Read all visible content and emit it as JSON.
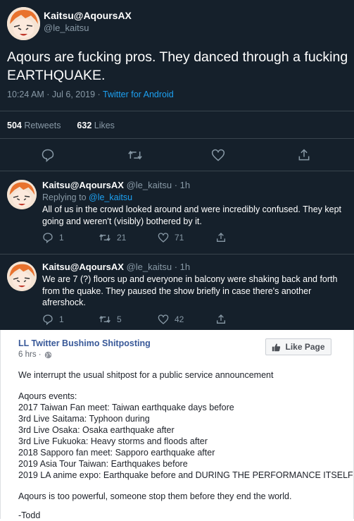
{
  "main_tweet": {
    "display_name": "Kaitsu@AqoursAX",
    "handle": "@le_kaitsu",
    "text": "Aqours are fucking pros. They danced through a fucking EARTHQUAKE.",
    "time": "10:24 AM · Jul 6, 2019 · ",
    "source": "Twitter for Android",
    "retweets_count": "504",
    "retweets_label": " Retweets",
    "likes_count": "632",
    "likes_label": " Likes"
  },
  "replies": [
    {
      "display_name": "Kaitsu@AqoursAX",
      "handle_time": "@le_kaitsu · 1h",
      "replying_prefix": "Replying to ",
      "replying_handle": "@le_kaitsu",
      "text": "All of us in the crowd looked around and were incredibly confused. They kept going and weren't (visibly) bothered by it.",
      "reply_count": "1",
      "retweet_count": "21",
      "like_count": "71"
    },
    {
      "display_name": "Kaitsu@AqoursAX",
      "handle_time": "@le_kaitsu · 1h",
      "text": "We are 7 (?) floors up and everyone in balcony were shaking back and forth from the quake. They paused the show briefly in case there's another afrershock.",
      "reply_count": "1",
      "retweet_count": "5",
      "like_count": "42"
    }
  ],
  "facebook_post": {
    "page_name": "LL Twitter Bushimo Shitposting",
    "time": "6 hrs · ",
    "like_page_label": "Like Page",
    "intro": "We interrupt the usual shitpost for a public service announcement",
    "events_heading": "Aqours events:",
    "events": [
      "2017 Taiwan Fan meet: Taiwan earthquake days before",
      "3rd Live Saitama: Typhoon during",
      "3rd Live Osaka: Osaka earthquake after",
      "3rd Live Fukuoka: Heavy storms and floods after",
      "2018 Sapporo fan meet: Sapporo earthquake after",
      "2019 Asia Tour Taiwan: Earthquakes before",
      "2019 LA anime expo: Earthquake before and DURING THE PERFORMANCE ITSELF"
    ],
    "closing": "Aqours is too powerful, someone stop them before they end the world.",
    "signature": "-Todd"
  },
  "icons": [
    "reply-icon",
    "retweet-icon",
    "like-icon",
    "share-icon",
    "globe-icon",
    "thumbs-up-icon"
  ],
  "colors": {
    "twitter_bg": "#15202b",
    "twitter_link": "#1da1f2",
    "twitter_muted": "#8899a6",
    "facebook_link": "#385898"
  }
}
